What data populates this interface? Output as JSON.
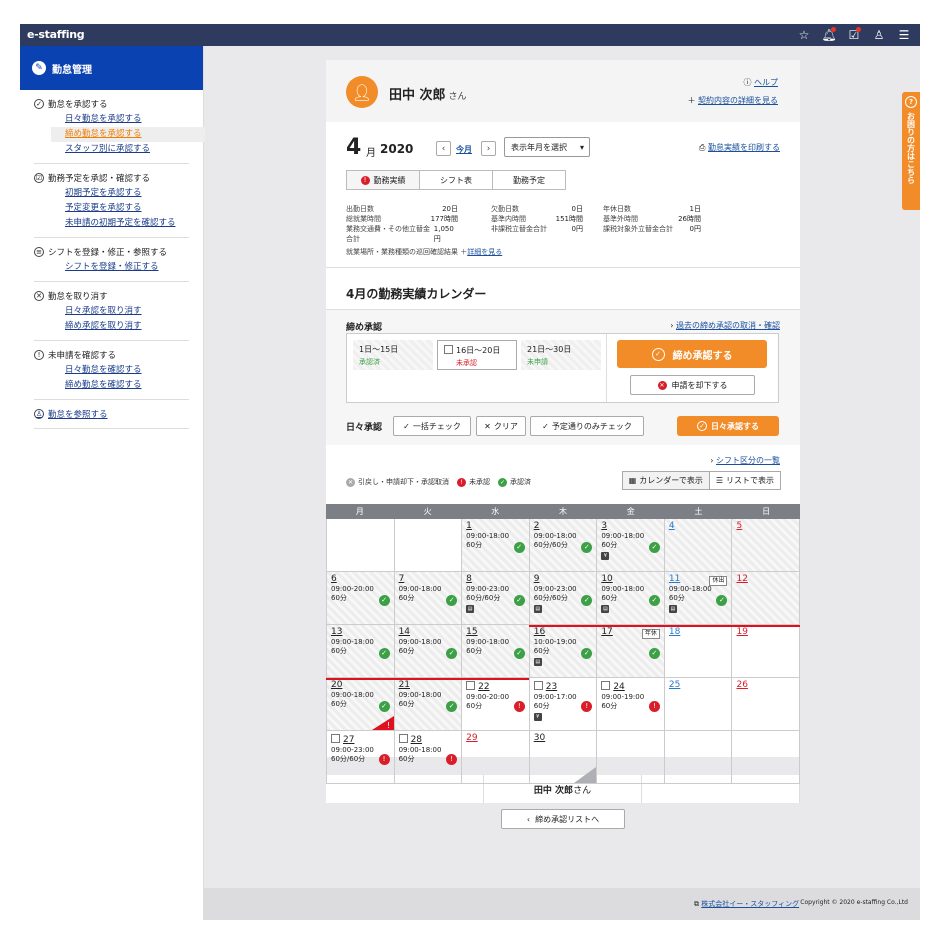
{
  "app": {
    "logo": "e-staffing"
  },
  "sidebar": {
    "title": "勤怠管理",
    "groups": [
      {
        "title": "勤怠を承認する",
        "items": [
          "日々勤怠を承認する",
          "締め勤怠を承認する",
          "スタッフ別に承認する"
        ]
      },
      {
        "title": "勤務予定を承認・確認する",
        "items": [
          "初期予定を承認する",
          "予定変更を承認する",
          "未申請の初期予定を確認する"
        ]
      },
      {
        "title": "シフトを登録・修正・参照する",
        "items": [
          "シフトを登録・修正する"
        ]
      },
      {
        "title": "勤怠を取り消す",
        "items": [
          "日々承認を取り消す",
          "締め承認を取り消す"
        ]
      },
      {
        "title": "未申請を確認する",
        "items": [
          "日々勤怠を確認する",
          "締め勤怠を確認する"
        ]
      },
      {
        "title": "勤怠を参照する",
        "items": []
      }
    ]
  },
  "header": {
    "name": "田中 次郎",
    "suffix": "さん",
    "help": "ヘルプ",
    "contract": "契約内容の詳細を見る"
  },
  "month": {
    "num": "4",
    "unit": "月",
    "year": "2020",
    "this_month": "今月",
    "select": "表示年月を選択",
    "print": "勤怠実績を印刷する",
    "tabs": [
      "勤務実績",
      "シフト表",
      "勤務予定"
    ],
    "stats": [
      [
        [
          "出勤日数",
          "20日"
        ],
        [
          "総就業時間",
          "177時間"
        ],
        [
          "業務交通費・その他立替金合計",
          "1,050円"
        ]
      ],
      [
        [
          "欠勤日数",
          "0日"
        ],
        [
          "基準内時間",
          "151時間"
        ],
        [
          "非課税立替金合計",
          "0円"
        ]
      ],
      [
        [
          "年休日数",
          "1日"
        ],
        [
          "基準外時間",
          "26時間"
        ],
        [
          "課税対象外立替金合計",
          "0円"
        ]
      ]
    ],
    "workplace": "就業場所・業務種類の巡回確認結果",
    "workplace_link": "詳細を見る"
  },
  "calendar": {
    "title": "4月の勤務実績カレンダー",
    "closing_label": "締め承認",
    "past_link": "過去の締め承認の取消・確認",
    "periods": [
      {
        "range": "1日〜15日",
        "status": "承認済"
      },
      {
        "range": "16日〜20日",
        "status": "未承認"
      },
      {
        "range": "21日〜30日",
        "status": "未申請"
      }
    ],
    "approve_btn": "締め承認する",
    "reject_btn": "申請を却下する",
    "daily_label": "日々承認",
    "bulk_check": "一括チェック",
    "clear": "クリア",
    "plan_check": "予定通りのみチェック",
    "daily_btn": "日々承認する",
    "shift_link": "シフト区分の一覧",
    "legend": [
      "引戻し・申請却下・承認取消",
      "未承認",
      "承認済"
    ],
    "view_cal": "カレンダーで表示",
    "view_list": "リストで表示",
    "weekdays": [
      "月",
      "火",
      "水",
      "木",
      "金",
      "土",
      "日"
    ],
    "weeks": [
      [
        {
          "d": ""
        },
        {
          "d": ""
        },
        {
          "d": "1",
          "t": "09:00-18:00",
          "b": "60分",
          "s": "g"
        },
        {
          "d": "2",
          "t": "09:00-18:00",
          "b": "60分/60分",
          "s": "g"
        },
        {
          "d": "3",
          "t": "09:00-18:00",
          "b": "60分",
          "s": "g",
          "ic": "¥"
        },
        {
          "d": "4",
          "c": "blue"
        },
        {
          "d": "5",
          "c": "red"
        }
      ],
      [
        {
          "d": "6",
          "t": "09:00-20:00",
          "b": "60分",
          "s": "g"
        },
        {
          "d": "7",
          "t": "09:00-18:00",
          "b": "60分",
          "s": "g"
        },
        {
          "d": "8",
          "t": "09:00-23:00",
          "b": "60分/60分",
          "s": "g",
          "ic": "▤"
        },
        {
          "d": "9",
          "t": "09:00-23:00",
          "b": "60分/60分",
          "s": "g",
          "ic": "▤"
        },
        {
          "d": "10",
          "t": "09:00-18:00",
          "b": "60分",
          "s": "g",
          "ic": "▤"
        },
        {
          "d": "11",
          "c": "blue",
          "t": "09:00-18:00",
          "b": "60分",
          "s": "g",
          "ic": "▤",
          "tag": "休出"
        },
        {
          "d": "12",
          "c": "red"
        }
      ],
      [
        {
          "d": "13",
          "t": "09:00-18:00",
          "b": "60分",
          "s": "g"
        },
        {
          "d": "14",
          "t": "09:00-18:00",
          "b": "60分",
          "s": "g"
        },
        {
          "d": "15",
          "t": "09:00-18:00",
          "b": "60分",
          "s": "g"
        },
        {
          "d": "16",
          "t": "10:00-19:00",
          "b": "60分",
          "s": "g",
          "ic": "▤"
        },
        {
          "d": "17",
          "s": "g",
          "tag": "年休"
        },
        {
          "d": "18",
          "c": "blue"
        },
        {
          "d": "19",
          "c": "red"
        }
      ],
      [
        {
          "d": "20",
          "t": "09:00-18:00",
          "b": "60分",
          "s": "g"
        },
        {
          "d": "21",
          "t": "09:00-18:00",
          "b": "60分",
          "s": "g"
        },
        {
          "d": "22",
          "cb": true,
          "t": "09:00-20:00",
          "b": "60分",
          "s": "r"
        },
        {
          "d": "23",
          "cb": true,
          "t": "09:00-17:00",
          "b": "60分",
          "s": "r",
          "ic": "¥"
        },
        {
          "d": "24",
          "cb": true,
          "t": "09:00-19:00",
          "b": "60分",
          "s": "r"
        },
        {
          "d": "25",
          "c": "blue"
        },
        {
          "d": "26",
          "c": "red"
        }
      ],
      [
        {
          "d": "27",
          "cb": true,
          "t": "09:00-23:00",
          "b": "60分/60分",
          "s": "r"
        },
        {
          "d": "28",
          "cb": true,
          "t": "09:00-18:00",
          "b": "60分",
          "s": "r"
        },
        {
          "d": "29",
          "c": "red"
        },
        {
          "d": "30"
        },
        {
          "d": ""
        },
        {
          "d": ""
        },
        {
          "d": ""
        }
      ]
    ]
  },
  "footer": {
    "name": "田中 次郎",
    "suffix": "さん",
    "back": "締め承認リストへ",
    "company": "株式会社イー・スタッフィング",
    "copyright": "Copyright © 2020 e-staffing Co.,Ltd"
  },
  "help_tab": "お困りの方はこちら"
}
